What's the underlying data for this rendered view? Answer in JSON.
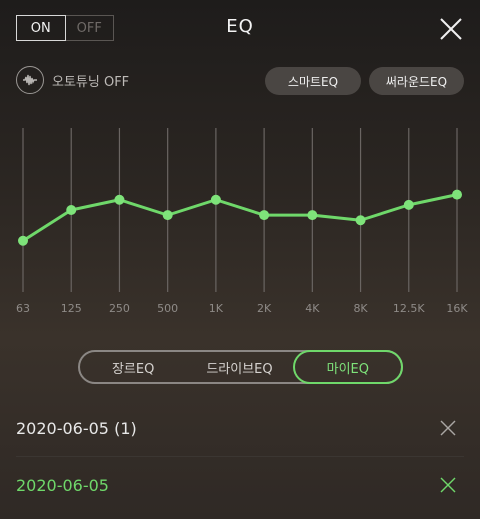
{
  "header": {
    "toggle_on": "ON",
    "toggle_off": "OFF",
    "title": "EQ",
    "close_icon": "close-icon"
  },
  "autotune": {
    "label": "오토튜닝 OFF",
    "icon": "waveform-icon"
  },
  "presets": {
    "smart": "스마트EQ",
    "surround": "써라운드EQ"
  },
  "colors": {
    "accent": "#6fd86a",
    "background": "#2b2622",
    "pill": "#4a4643"
  },
  "chart_data": {
    "type": "line",
    "categories": [
      "63",
      "125",
      "250",
      "500",
      "1K",
      "2K",
      "4K",
      "8K",
      "12.5K",
      "16K"
    ],
    "series": [
      {
        "values": [
          -3.0,
          0.0,
          1.0,
          -0.5,
          1.0,
          -0.5,
          -0.5,
          -1.0,
          0.5,
          1.5
        ]
      }
    ],
    "ylim": [
      -8,
      8
    ],
    "grid": "vertical"
  },
  "tabs": [
    {
      "label": "장르EQ"
    },
    {
      "label": "드라이브EQ"
    },
    {
      "label": "마이EQ"
    }
  ],
  "active_tab": "마이EQ",
  "items": [
    {
      "name": "2020-06-05 (1)"
    },
    {
      "name": "2020-06-05"
    }
  ],
  "selected_item": "2020-06-05"
}
